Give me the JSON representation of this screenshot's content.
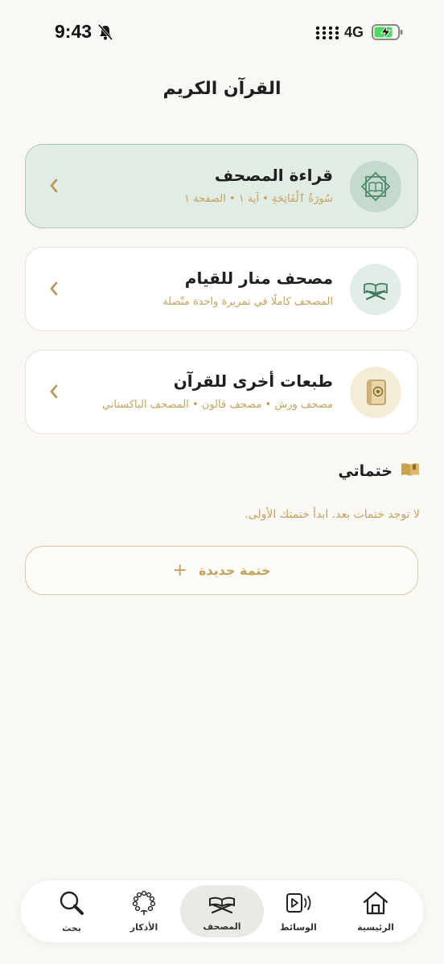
{
  "status": {
    "time": "9:43",
    "network": "4G"
  },
  "header": {
    "title": "القرآن الكريم"
  },
  "cards": [
    {
      "title": "قراءة المصحف",
      "subtitle": "سُورَةُ ٱلْفَاتِحَةِ • آية ١ • الصفحة ١",
      "icon": "octagram-book-icon"
    },
    {
      "title": "مصحف منار للقيام",
      "subtitle": "المصحف كاملًا في تمريرة واحدة متّصلة",
      "icon": "quran-stand-icon"
    },
    {
      "title": "طبعات أخرى للقرآن",
      "subtitle": "مصحف ورش • مصحف قالون • المصحف الباكستاني",
      "icon": "quran-book-icon"
    }
  ],
  "khatmat": {
    "title": "ختماتي",
    "empty_message": "لا توجد ختمات بعد. ابدأ ختمتك الأولى.",
    "new_button": "ختمة جديدة"
  },
  "tabs": [
    {
      "label": "الرئيسية",
      "icon": "home-icon"
    },
    {
      "label": "الوسائط",
      "icon": "media-icon"
    },
    {
      "label": "المصحف",
      "icon": "quran-stand-icon"
    },
    {
      "label": "الأذكار",
      "icon": "prayer-beads-icon"
    },
    {
      "label": "بحث",
      "icon": "search-icon"
    }
  ],
  "colors": {
    "accent": "#c4a25c",
    "active_card": "#e1ece4",
    "background": "#f9f8f4"
  }
}
